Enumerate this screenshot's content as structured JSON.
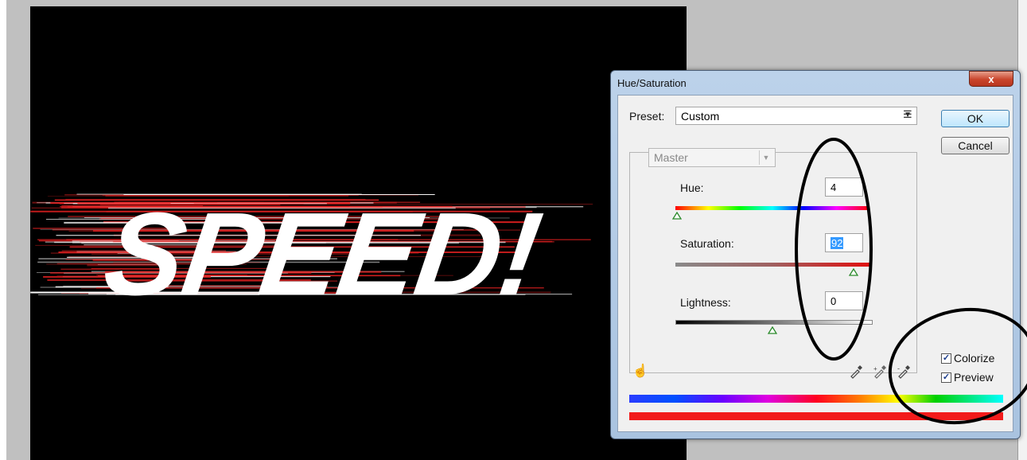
{
  "canvas": {
    "text": "SPEED!",
    "background": "#000000",
    "text_color": "#ffffff",
    "streak_color": "#e02020"
  },
  "dialog": {
    "title": "Hue/Saturation",
    "close_label": "x",
    "preset_label": "Preset:",
    "preset_value": "Custom",
    "ok_label": "OK",
    "cancel_label": "Cancel",
    "channel_value": "Master",
    "hue": {
      "label": "Hue:",
      "value": "4",
      "slider_fraction": 0.01
    },
    "saturation": {
      "label": "Saturation:",
      "value": "92",
      "slider_fraction": 0.92
    },
    "lightness": {
      "label": "Lightness:",
      "value": "0",
      "slider_fraction": 0.5
    },
    "colorize": {
      "label": "Colorize",
      "checked": true
    },
    "preview": {
      "label": "Preview",
      "checked": true
    }
  },
  "icons": [
    "preset-menu-icon",
    "targeted-adjustment-icon",
    "eyedropper-icon",
    "eyedropper-plus-icon",
    "eyedropper-minus-icon",
    "dropdown-arrow-icon",
    "close-icon"
  ],
  "colors": {
    "accent": "#3399ff",
    "dialog_frame": "#a9c3e0",
    "annotation": "#000000"
  }
}
